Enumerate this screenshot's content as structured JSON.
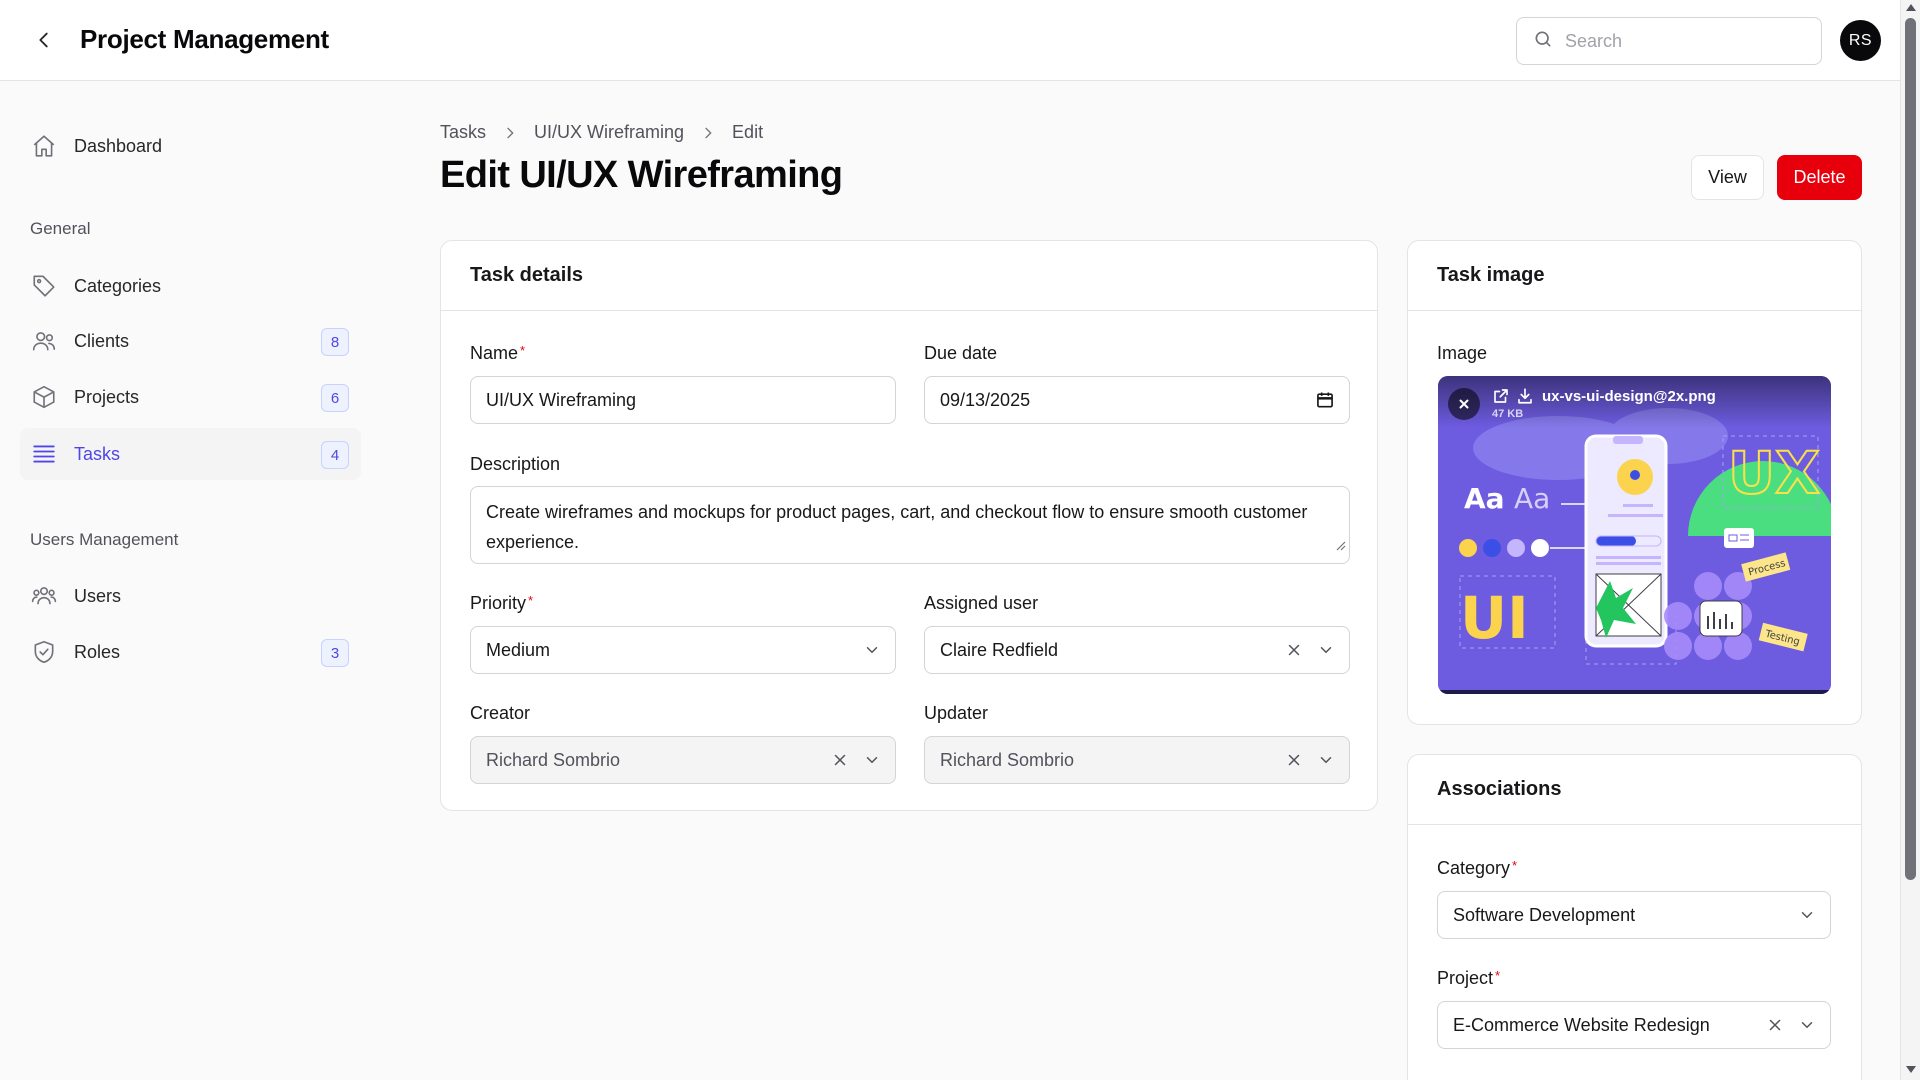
{
  "header": {
    "title": "Project Management",
    "search_placeholder": "Search",
    "avatar_initials": "RS"
  },
  "sidebar": {
    "dashboard": "Dashboard",
    "general_heading": "General",
    "categories": "Categories",
    "clients": "Clients",
    "clients_count": "8",
    "projects": "Projects",
    "projects_count": "6",
    "tasks": "Tasks",
    "tasks_count": "4",
    "users_heading": "Users Management",
    "users": "Users",
    "roles": "Roles",
    "roles_count": "3",
    "active_item": "Tasks"
  },
  "breadcrumb": [
    "Tasks",
    "UI/UX Wireframing",
    "Edit"
  ],
  "page": {
    "title": "Edit UI/UX Wireframing",
    "view_label": "View",
    "delete_label": "Delete"
  },
  "task_details": {
    "heading": "Task details",
    "name_label": "Name",
    "name_value": "UI/UX Wireframing",
    "due_label": "Due date",
    "due_value": "2025-09-13",
    "description_label": "Description",
    "description_value": "Create wireframes and mockups for product pages, cart, and checkout flow to ensure smooth customer experience.",
    "priority_label": "Priority",
    "priority_value": "Medium",
    "assigned_label": "Assigned user",
    "assigned_value": "Claire Redfield",
    "creator_label": "Creator",
    "creator_value": "Richard Sombrio",
    "updater_label": "Updater",
    "updater_value": "Richard Sombrio"
  },
  "task_image": {
    "heading": "Task image",
    "image_label": "Image",
    "file_name": "ux-vs-ui-design@2x.png",
    "file_size": "47 KB",
    "art_text": {
      "ux": "UX",
      "ui": "UI",
      "font_sample_bold": "Aa",
      "font_sample_light": "Aa",
      "tag_process": "Process",
      "tag_testing": "Testing"
    }
  },
  "associations": {
    "heading": "Associations",
    "category_label": "Category",
    "category_value": "Software Development",
    "project_label": "Project",
    "project_value": "E-Commerce Website Redesign"
  },
  "colors": {
    "accent": "#4f46e5",
    "danger": "#e7000b",
    "image_bg": "#6d5ce0"
  }
}
